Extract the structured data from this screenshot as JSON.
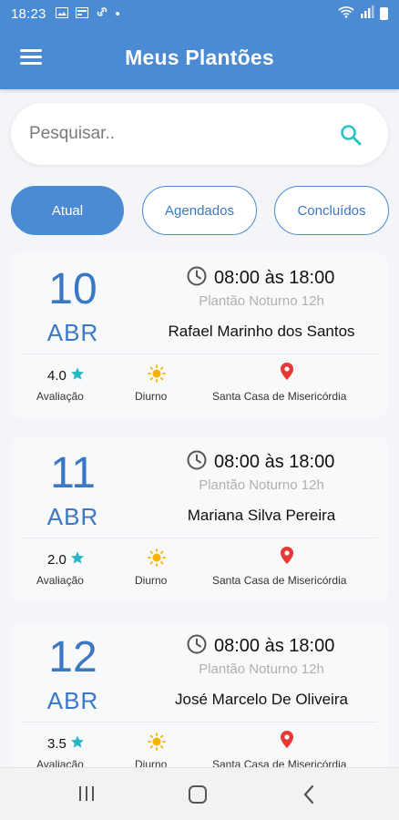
{
  "status_bar": {
    "time": "18:23",
    "dot": "•"
  },
  "app_bar": {
    "title": "Meus Plantões"
  },
  "search": {
    "placeholder": "Pesquisar.."
  },
  "tabs": [
    {
      "label": "Atual",
      "active": true
    },
    {
      "label": "Agendados",
      "active": false
    },
    {
      "label": "Concluídos",
      "active": false
    }
  ],
  "shifts": [
    {
      "day": "10",
      "month": "ABR",
      "time": "08:00 às 18:00",
      "subtitle": "Plantão Noturno 12h",
      "name": "Rafael Marinho dos Santos",
      "rating": "4.0",
      "rating_label": "Avaliação",
      "shift_label": "Diurno",
      "location": "Santa Casa de Misericórdia"
    },
    {
      "day": "11",
      "month": "ABR",
      "time": "08:00 às 18:00",
      "subtitle": "Plantão Noturno 12h",
      "name": "Mariana Silva Pereira",
      "rating": "2.0",
      "rating_label": "Avaliação",
      "shift_label": "Diurno",
      "location": "Santa Casa de Misericórdia"
    },
    {
      "day": "12",
      "month": "ABR",
      "time": "08:00 às 18:00",
      "subtitle": "Plantão Noturno 12h",
      "name": "José Marcelo De Oliveira",
      "rating": "3.5",
      "rating_label": "Avaliação",
      "shift_label": "Diurno",
      "location": "Santa Casa de Misericórdia"
    }
  ],
  "colors": {
    "primary": "#4a8bd3",
    "accent": "#26c6c6",
    "sun": "#f5b400",
    "pin": "#e53935",
    "star": "#26b6c6"
  },
  "icons": [
    "menu-icon",
    "search-icon",
    "clock-icon",
    "star-icon",
    "sun-icon",
    "location-pin-icon",
    "recent-apps-icon",
    "home-icon",
    "back-icon"
  ]
}
